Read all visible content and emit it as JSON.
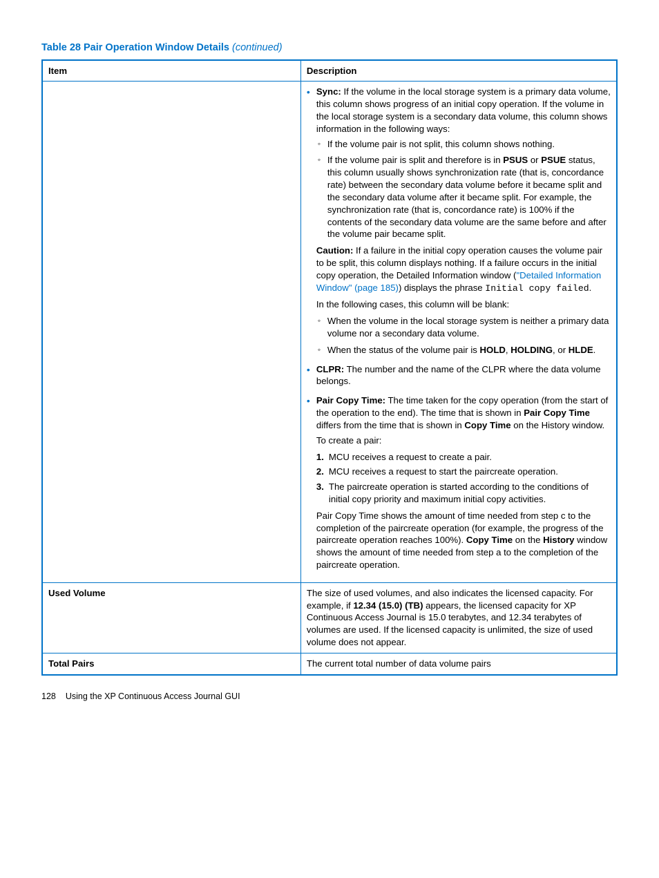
{
  "caption": {
    "label": "Table 28 Pair Operation Window Details",
    "continued": "(continued)"
  },
  "header": {
    "item": "Item",
    "description": "Description"
  },
  "rows": {
    "r0": {
      "item": ""
    },
    "r1": {
      "item": "Used Volume"
    },
    "r2": {
      "item": "Total Pairs"
    }
  },
  "desc": {
    "sync_lead": "Sync:",
    "sync_body": " If the volume in the local storage system is a primary data volume, this column shows progress of an initial copy operation. If the volume in the local storage system is a secondary data volume, this column shows information in the following ways:",
    "sync_sub1": "If the volume pair is not split, this column shows nothing.",
    "sync_sub2_a": "If the volume pair is split and therefore is in ",
    "psus": "PSUS",
    "or_word": " or ",
    "psue": "PSUE",
    "sync_sub2_b": " status, this column usually shows synchronization rate (that is, concordance rate) between the secondary data volume before it became split and the secondary data volume after it became split. For example, the synchronization rate (that is, concordance rate) is 100% if the contents of the secondary data volume are the same before and after the volume pair became split.",
    "caution_lead": "Caution:",
    "caution_body_a": " If a failure in the initial copy operation causes the volume pair to be split, this column displays nothing. If a failure occurs in the initial copy operation, the Detailed Information window (",
    "caution_link": "\"Detailed Information Window\" (page 185)",
    "caution_body_b": ") displays the phrase ",
    "copy_failed": "Initial copy failed",
    "caution_body_c": ".",
    "blank_cases": "In the following cases, this column will be blank:",
    "blank_sub1": "When the volume in the local storage system is neither a primary data volume nor a secondary data volume.",
    "blank_sub2_a": "When the status of the volume pair is ",
    "hold": "HOLD",
    "holding": "HOLDING",
    "hlde": "HLDE",
    "blank_sub2_sep1": ", ",
    "blank_sub2_sep2": ", or ",
    "blank_sub2_end": ".",
    "clpr_lead": "CLPR:",
    "clpr_body": " The number and the name of the CLPR where the data volume belongs.",
    "pair_lead": "Pair Copy Time:",
    "pair_body_a": " The time taken for the copy operation (from the start of the operation to the end). The time that is shown in ",
    "pair_copy_time_b": "Pair Copy Time",
    "pair_body_b": " differs from the time that is shown in ",
    "copy_time_b": "Copy Time",
    "pair_body_c": " on the History window.",
    "to_create": "To create a pair:",
    "step1": "MCU receives a request to create a pair.",
    "step2": "MCU receives a request to start the paircreate operation.",
    "step3": "The paircreate operation is started according to the conditions of initial copy priority and maximum initial copy activities.",
    "final_a": "Pair Copy Time shows the amount of time needed from step c to the completion of the paircreate operation (for example, the progress of the paircreate operation reaches 100%). ",
    "final_b": " on the ",
    "history_b": "History",
    "final_c": " window shows the amount of time needed from step a to the completion of the paircreate operation.",
    "used_vol_a": "The size of used volumes, and also indicates the licensed capacity. For example, if ",
    "used_vol_val": "12.34 (15.0) (TB)",
    "used_vol_b": " appears, the licensed capacity for XP Continuous Access Journal is 15.0 terabytes, and 12.34 terabytes of volumes are used. If the licensed capacity is unlimited, the size of used volume does not appear.",
    "total_pairs": "The current total number of data volume pairs"
  },
  "footer": {
    "page": "128",
    "label": "Using the XP Continuous Access Journal GUI"
  }
}
